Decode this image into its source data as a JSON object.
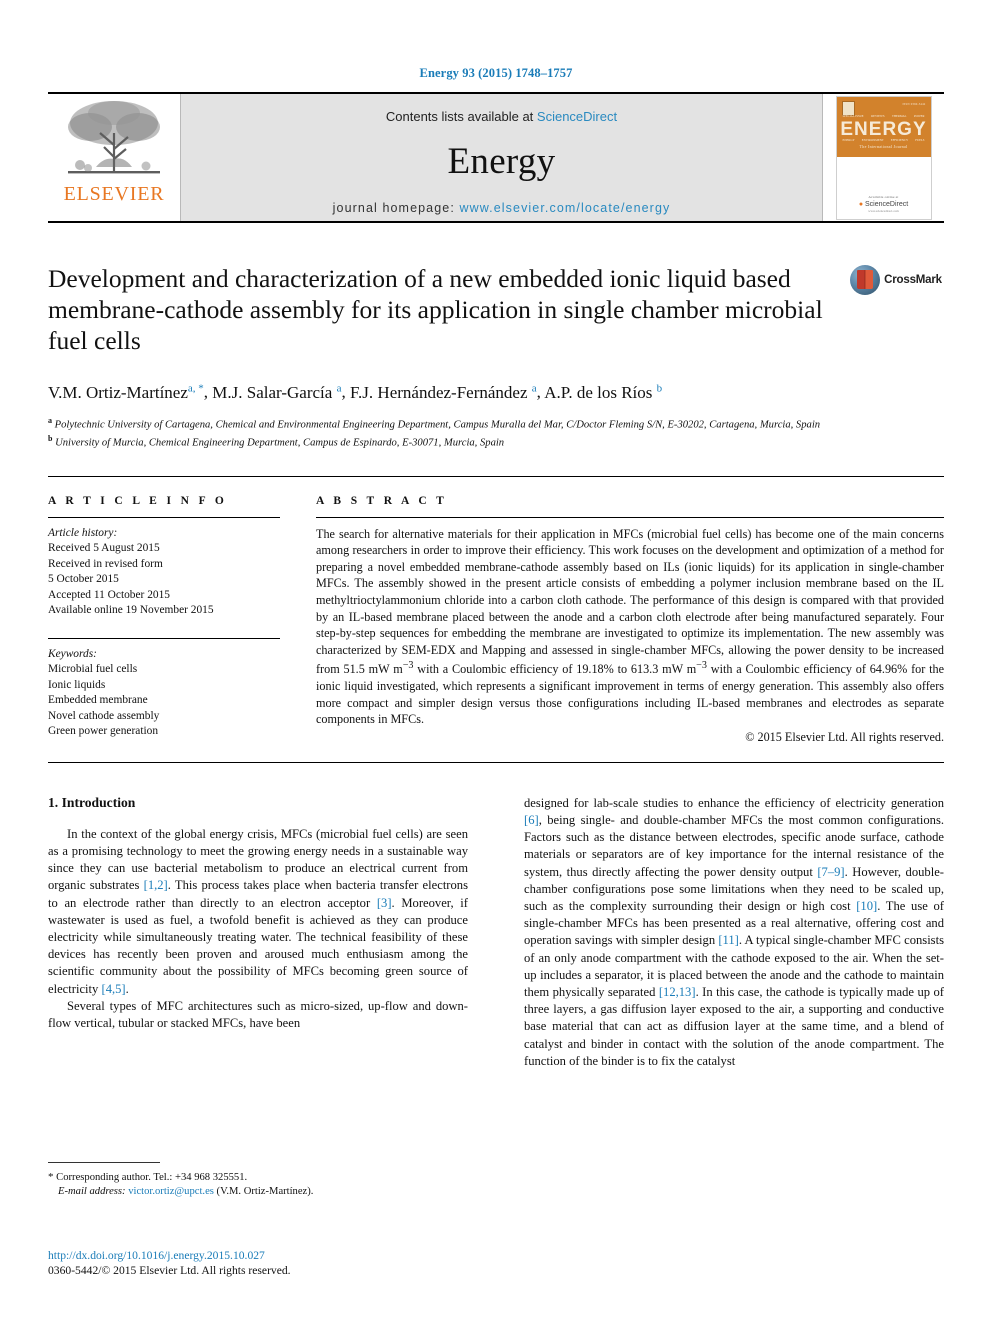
{
  "running_head": "Energy 93 (2015) 1748–1757",
  "masthead": {
    "contents_prefix": "Contents lists available at ",
    "sciencedirect": "ScienceDirect",
    "journal_name": "Energy",
    "homepage_prefix": "journal homepage: ",
    "homepage_url": "www.elsevier.com/locate/energy",
    "publisher_word": "ELSEVIER",
    "cover": {
      "title": "ENERGY",
      "subtitle": "The International Journal",
      "corner_label": "ISSN 0360-5442",
      "strip": [
        "SPECIAL ISSUE",
        "REVIEWS",
        "THERMAL",
        "POWER"
      ],
      "strip2": [
        "ENERGY",
        "ENVIRONMENT",
        "EFFICIENCY",
        "FUELS"
      ],
      "published_by": "Available online at",
      "platform": "ScienceDirect",
      "platform_url": "www.sciencedirect.com"
    }
  },
  "article": {
    "title": "Development and characterization of a new embedded ionic liquid based membrane-cathode assembly for its application in single chamber microbial fuel cells",
    "crossmark_label": "CrossMark",
    "authors": [
      {
        "name": "V.M. Ortiz-Martínez",
        "marks": "a, *"
      },
      {
        "name": "M.J. Salar-García",
        "marks": "a"
      },
      {
        "name": "F.J. Hernández-Fernández",
        "marks": "a"
      },
      {
        "name": "A.P. de los Ríos",
        "marks": "b"
      }
    ],
    "affiliations": [
      {
        "mark": "a",
        "text": "Polytechnic University of Cartagena, Chemical and Environmental Engineering Department, Campus Muralla del Mar, C/Doctor Fleming S/N, E-30202, Cartagena, Murcia, Spain"
      },
      {
        "mark": "b",
        "text": "University of Murcia, Chemical Engineering Department, Campus de Espinardo, E-30071, Murcia, Spain"
      }
    ]
  },
  "article_info": {
    "heading": "A R T I C L E   I N F O",
    "history_label": "Article history:",
    "history": [
      "Received 5 August 2015",
      "Received in revised form",
      "5 October 2015",
      "Accepted 11 October 2015",
      "Available online 19 November 2015"
    ],
    "keywords_label": "Keywords:",
    "keywords": [
      "Microbial fuel cells",
      "Ionic liquids",
      "Embedded membrane",
      "Novel cathode assembly",
      "Green power generation"
    ]
  },
  "abstract": {
    "heading": "A B S T R A C T",
    "text": "The search for alternative materials for their application in MFCs (microbial fuel cells) has become one of the main concerns among researchers in order to improve their efficiency. This work focuses on the development and optimization of a method for preparing a novel embedded membrane-cathode assembly based on ILs (ionic liquids) for its application in single-chamber MFCs. The assembly showed in the present article consists of embedding a polymer inclusion membrane based on the IL methyltrioctylammonium chloride into a carbon cloth cathode. The performance of this design is compared with that provided by an IL-based membrane placed between the anode and a carbon cloth electrode after being manufactured separately. Four step-by-step sequences for embedding the membrane are investigated to optimize its implementation. The new assembly was characterized by SEM-EDX and Mapping and assessed in single-chamber MFCs, allowing the power density to be increased from 51.5 mW m−3 with a Coulombic efficiency of 19.18% to 613.3 mW m−3 with a Coulombic efficiency of 64.96% for the ionic liquid investigated, which represents a significant improvement in terms of energy generation. This assembly also offers more compact and simpler design versus those configurations including IL-based membranes and electrodes as separate components in MFCs.",
    "copyright": "© 2015 Elsevier Ltd. All rights reserved."
  },
  "introduction": {
    "heading": "1. Introduction",
    "left_paragraph_1": "In the context of the global energy crisis, MFCs (microbial fuel cells) are seen as a promising technology to meet the growing energy needs in a sustainable way since they can use bacterial metabolism to produce an electrical current from organic substrates [1,2]. This process takes place when bacteria transfer electrons to an electrode rather than directly to an electron acceptor [3]. Moreover, if wastewater is used as fuel, a twofold benefit is achieved as they can produce electricity while simultaneously treating water. The technical feasibility of these devices has recently been proven and aroused much enthusiasm among the scientific community about the possibility of MFCs becoming green source of electricity [4,5].",
    "left_paragraph_2": "Several types of MFC architectures such as micro-sized, up-flow and down-flow vertical, tubular or stacked MFCs, have been",
    "right_paragraph": "designed for lab-scale studies to enhance the efficiency of electricity generation [6], being single- and double-chamber MFCs the most common configurations. Factors such as the distance between electrodes, specific anode surface, cathode materials or separators are of key importance for the internal resistance of the system, thus directly affecting the power density output [7–9]. However, double-chamber configurations pose some limitations when they need to be scaled up, such as the complexity surrounding their design or high cost [10]. The use of single-chamber MFCs has been presented as a real alternative, offering cost and operation savings with simpler design [11]. A typical single-chamber MFC consists of an only anode compartment with the cathode exposed to the air. When the set-up includes a separator, it is placed between the anode and the cathode to maintain them physically separated [12,13]. In this case, the cathode is typically made up of three layers, a gas diffusion layer exposed to the air, a supporting and conductive base material that can act as diffusion layer at the same time, and a blend of catalyst and binder in contact with the solution of the anode compartment. The function of the binder is to fix the catalyst"
  },
  "footer": {
    "corresponding_marker": "*",
    "corresponding": "Corresponding author. Tel.: +34 968 325551.",
    "email_label": "E-mail address:",
    "email": "victor.ortiz@upct.es",
    "email_owner": "(V.M. Ortiz-Martínez).",
    "doi": "http://dx.doi.org/10.1016/j.energy.2015.10.027",
    "issn": "0360-5442/© 2015 Elsevier Ltd. All rights reserved."
  },
  "colors": {
    "link_blue": "#1a7cb8",
    "elsevier_orange": "#E87722",
    "masthead_gray": "#e3e3e3",
    "cover_orange": "#d2822c"
  }
}
